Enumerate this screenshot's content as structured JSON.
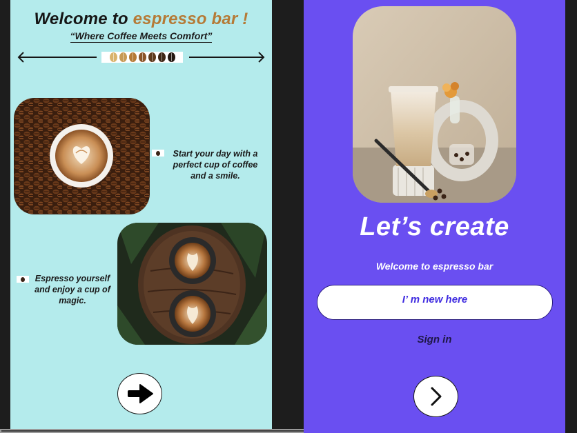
{
  "welcome_screen": {
    "title_prefix": "Welcome to ",
    "title_accent": "espresso bar !",
    "tagline": "“Where Coffee Meets Comfort”",
    "feature_1_text": "Start your day with a perfect cup of coffee and a smile.",
    "feature_2_text": "Espresso yourself and enjoy a cup of magic.",
    "bean_colors": [
      "#d9b36c",
      "#c79a55",
      "#b57a36",
      "#8a5428",
      "#5e3a1c",
      "#3d2615",
      "#241811"
    ],
    "accent_color": "#b57a36",
    "background_color": "#b4ebec",
    "next_icon": "arrow-right-icon"
  },
  "create_screen": {
    "headline": "Let’s create",
    "welcome_text": "Welcome to espresso bar",
    "new_here_label": "I’ m new here",
    "sign_in_label": "Sign in",
    "background_color": "#6a4ff1",
    "next_icon": "chevron-right-icon"
  }
}
